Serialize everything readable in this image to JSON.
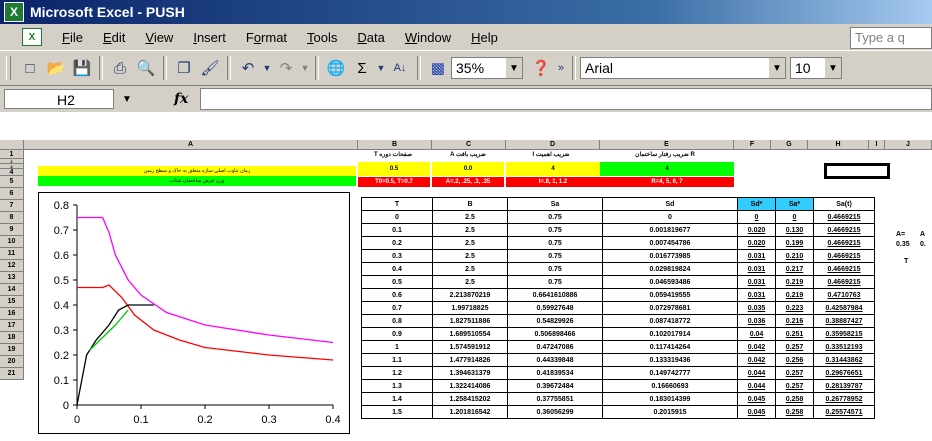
{
  "window": {
    "title": "Microsoft Excel - PUSH",
    "app_icon_letter": "X"
  },
  "menu": {
    "items": [
      {
        "label": "File",
        "key": "F"
      },
      {
        "label": "Edit",
        "key": "E"
      },
      {
        "label": "View",
        "key": "V"
      },
      {
        "label": "Insert",
        "key": "I"
      },
      {
        "label": "Format",
        "key": "o"
      },
      {
        "label": "Tools",
        "key": "T"
      },
      {
        "label": "Data",
        "key": "D"
      },
      {
        "label": "Window",
        "key": "W"
      },
      {
        "label": "Help",
        "key": "H"
      }
    ],
    "help_placeholder": "Type a q"
  },
  "toolbar": {
    "zoom": "35%",
    "font": "Arial",
    "font_size": "10"
  },
  "formula_bar": {
    "name_box": "H2",
    "fx": "fx"
  },
  "columns": [
    "A",
    "B",
    "C",
    "D",
    "E",
    "F",
    "G",
    "H",
    "I",
    "J"
  ],
  "rows": [
    "1",
    "2",
    "3",
    "4",
    "5",
    "6",
    "7",
    "8",
    "9",
    "10",
    "11",
    "12",
    "13",
    "14",
    "15",
    "16",
    "17",
    "18",
    "19",
    "20",
    "21"
  ],
  "bands": {
    "b_top": "T‍ صفحات دوره",
    "c_top": "A ضريب بافت",
    "d_top": "I ضريب اهميت",
    "e_top": "ضريب رفتار ساختمان R",
    "b_val": "0.5",
    "c_val": "0.0",
    "d_val": "4",
    "e_val": "4",
    "b_bot": "T0=0.5, T=0.7",
    "c_bot": "A=.2, .25, .3, .35",
    "d_bot": "I=.8, 1, 1.2",
    "e_bot": "R=4, 5, 6, 7",
    "yellow_text": "زمان تناوب اصلي سازه متعلق به خاک و سطح زمين",
    "green_text": "وزن عرض ساختمان شتاب"
  },
  "table": {
    "headers": [
      "T",
      "B",
      "Sa",
      "Sd",
      "Sd*",
      "Sa*",
      "Sa(t)"
    ],
    "rows": [
      [
        "0",
        "2.5",
        "0.75",
        "0",
        "0",
        "0",
        "0.4669215"
      ],
      [
        "0.1",
        "2.5",
        "0.75",
        "0.001819677",
        "0.020",
        "0.130",
        "0.4669215"
      ],
      [
        "0.2",
        "2.5",
        "0.75",
        "0.007454786",
        "0.020",
        "0.199",
        "0.4669215"
      ],
      [
        "0.3",
        "2.5",
        "0.75",
        "0.016773985",
        "0.031",
        "0.210",
        "0.4669215"
      ],
      [
        "0.4",
        "2.5",
        "0.75",
        "0.029819824",
        "0.031",
        "0.217",
        "0.4669215"
      ],
      [
        "0.5",
        "2.5",
        "0.75",
        "0.046593486",
        "0.031",
        "0.219",
        "0.4669215"
      ],
      [
        "0.6",
        "2.213870219",
        "0.6641610886",
        "0.059419555",
        "0.031",
        "0.219",
        "0.4710763"
      ],
      [
        "0.7",
        "1.99718825",
        "0.59927648",
        "0.072978681",
        "0.035",
        "0.223",
        "0.42587984"
      ],
      [
        "0.8",
        "1.827511886",
        "0.54829926",
        "0.087418772",
        "0.036",
        "0.216",
        "0.38887427"
      ],
      [
        "0.9",
        "1.689510554",
        "0.506898466",
        "0.102017914",
        "0.04",
        "0.251",
        "0.35958215"
      ],
      [
        "1",
        "1.574591912",
        "0.47247086",
        "0.117414264",
        "0.042",
        "0.257",
        "0.33512193"
      ],
      [
        "1.1",
        "1.477914826",
        "0.44339848",
        "0.133319436",
        "0.042",
        "0.256",
        "0.31443862"
      ],
      [
        "1.2",
        "1.394631379",
        "0.41839534",
        "0.149742777",
        "0.044",
        "0.257",
        "0.29676651"
      ],
      [
        "1.3",
        "1.322414086",
        "0.39672484",
        "0.16660693",
        "0.044",
        "0.257",
        "0.28139787"
      ],
      [
        "1.4",
        "1.258415202",
        "0.37755851",
        "0.183014399",
        "0.045",
        "0.258",
        "0.26778952"
      ],
      [
        "1.5",
        "1.201816542",
        "0.36056299",
        "0.2015915",
        "0.045",
        "0.258",
        "0.25574571"
      ]
    ]
  },
  "right_labels": {
    "a": "A=",
    "b": "0.35",
    "c": "T",
    "d": "A",
    "e": "0."
  },
  "chart_data": {
    "type": "line",
    "title": "",
    "xlabel": "",
    "ylabel": "",
    "xlim": [
      0,
      0.4
    ],
    "ylim": [
      0,
      0.8
    ],
    "xticks": [
      "0",
      "0.1",
      "0.2",
      "0.3",
      "0.4"
    ],
    "yticks": [
      "0",
      "0.1",
      "0.2",
      "0.3",
      "0.4",
      "0.5",
      "0.6",
      "0.7",
      "0.8"
    ],
    "series": [
      {
        "color": "#ff00ff",
        "x": [
          0,
          0.02,
          0.04,
          0.05,
          0.06,
          0.08,
          0.1,
          0.14,
          0.2,
          0.3,
          0.4
        ],
        "y": [
          0.75,
          0.75,
          0.75,
          0.69,
          0.6,
          0.5,
          0.44,
          0.37,
          0.32,
          0.28,
          0.25
        ]
      },
      {
        "color": "#ff0000",
        "x": [
          0,
          0.02,
          0.04,
          0.05,
          0.07,
          0.09,
          0.12,
          0.16,
          0.2,
          0.3,
          0.4
        ],
        "y": [
          0.47,
          0.47,
          0.47,
          0.48,
          0.43,
          0.36,
          0.3,
          0.26,
          0.23,
          0.2,
          0.18
        ]
      },
      {
        "color": "#000000",
        "x": [
          0,
          0.015,
          0.03,
          0.05,
          0.065,
          0.08,
          0.1,
          0.12
        ],
        "y": [
          0,
          0.2,
          0.26,
          0.32,
          0.38,
          0.4,
          0.4,
          0.4
        ]
      },
      {
        "color": "#00cc00",
        "x": [
          0.02,
          0.04,
          0.06,
          0.08
        ],
        "y": [
          0.22,
          0.27,
          0.32,
          0.38
        ]
      }
    ]
  }
}
